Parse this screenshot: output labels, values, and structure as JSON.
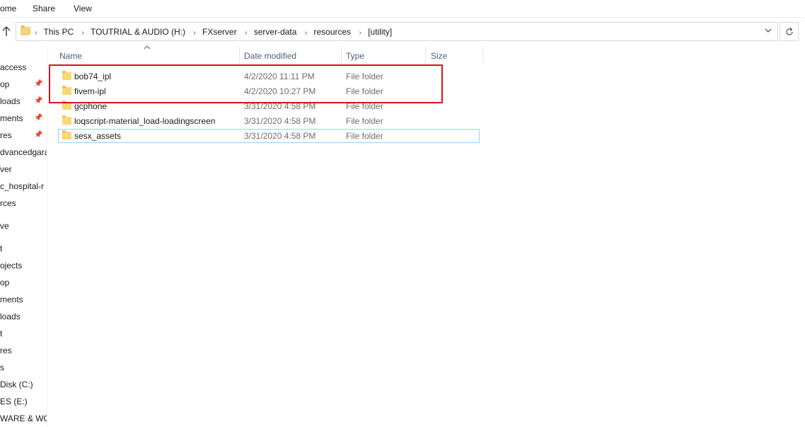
{
  "ribbon": {
    "tabs": [
      "ome",
      "Share",
      "View"
    ]
  },
  "address": {
    "crumbs": [
      "This PC",
      "TOUTRIAL & AUDIO (H:)",
      "FXserver",
      "server-data",
      "resources",
      "[utility]"
    ],
    "up_icon": "up-arrow-icon",
    "refresh_icon": "refresh-icon"
  },
  "nav": {
    "items": [
      "access",
      "op",
      "loads",
      "ments",
      "res",
      "dvancedgara",
      "ver",
      "c_hospital-r",
      "rces",
      "ve",
      "t",
      "ojects",
      "op",
      "ments",
      "loads",
      "t",
      "res",
      "s",
      "Disk (C:)",
      "ES (E:)",
      "WARE & WC"
    ]
  },
  "columns": {
    "name": "Name",
    "date": "Date modified",
    "type": "Type",
    "size": "Size"
  },
  "files": [
    {
      "name": "bob74_ipl",
      "date": "4/2/2020 11:11 PM",
      "type": "File folder"
    },
    {
      "name": "fivem-ipl",
      "date": "4/2/2020 10:27 PM",
      "type": "File folder"
    },
    {
      "name": "gcphone",
      "date": "3/31/2020 4:58 PM",
      "type": "File folder"
    },
    {
      "name": "loqscript-material_load-loadingscreen",
      "date": "3/31/2020 4:58 PM",
      "type": "File folder"
    },
    {
      "name": "sesx_assets",
      "date": "3/31/2020 4:58 PM",
      "type": "File folder"
    }
  ],
  "colors": {
    "highlight_box": "#e0101a",
    "focus_border": "#99d1ff",
    "folder": "#f8d775"
  }
}
